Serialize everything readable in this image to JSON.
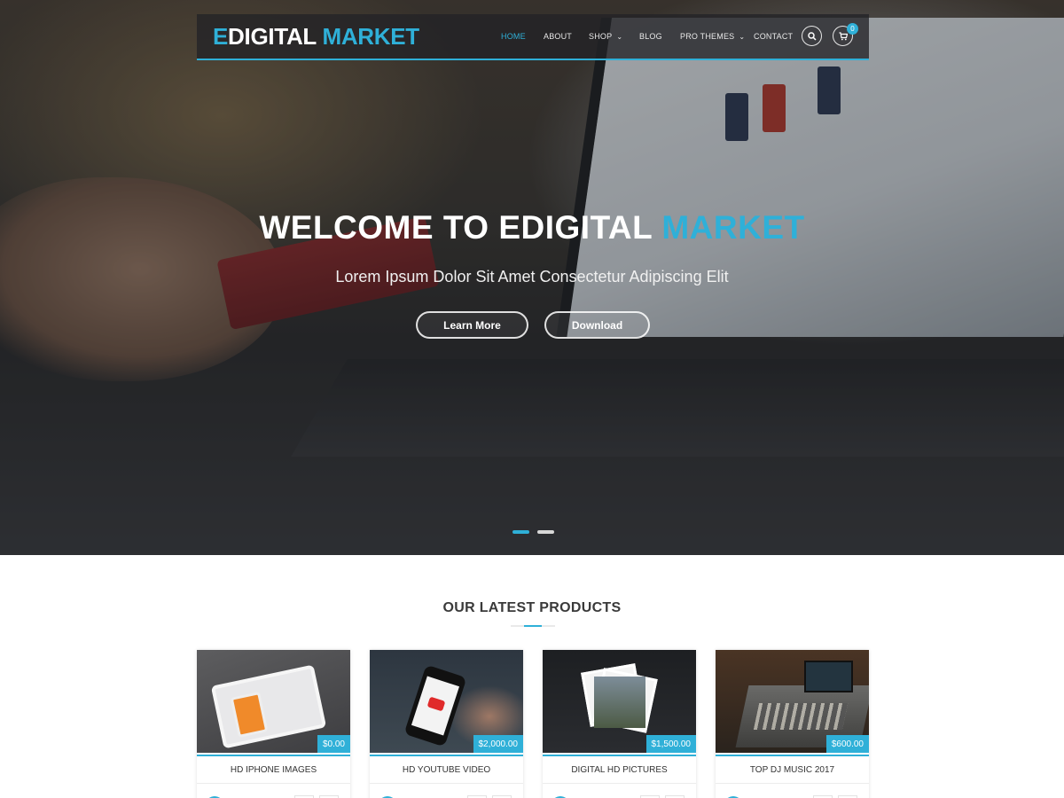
{
  "header": {
    "logo_prefix": "E",
    "logo_mid": "DIGITAL ",
    "logo_accent": "MARKET",
    "nav": [
      {
        "label": "HOME",
        "active": true
      },
      {
        "label": "ABOUT"
      },
      {
        "label": "SHOP"
      },
      {
        "label": "BLOG"
      },
      {
        "label": "PRO THEMES"
      },
      {
        "label": "CONTACT"
      }
    ],
    "search_icon": "search-icon",
    "cart_icon": "cart-icon",
    "cart_count": "0"
  },
  "hero": {
    "title_main": "WELCOME TO EDIGITAL ",
    "title_accent": "MARKET",
    "subtitle": "Lorem Ipsum Dolor Sit Amet Consectetur Adipiscing Elit",
    "learn_more": "Learn More",
    "download": "Download",
    "slides": [
      {
        "active": true
      },
      {
        "active": false
      }
    ]
  },
  "products": {
    "title": "OUR LATEST PRODUCTS",
    "items": [
      {
        "name": "HD IPHONE IMAGES",
        "price": "$0.00"
      },
      {
        "name": "HD YOUTUBE VIDEO",
        "price": "$2,000.00"
      },
      {
        "name": "DIGITAL HD PICTURES",
        "price": "$1,500.00"
      },
      {
        "name": "TOP DJ MUSIC 2017",
        "price": "$600.00"
      }
    ]
  },
  "colors": {
    "accent": "#2fb0d8",
    "header_bg": "#232326",
    "text_dark": "#3a3a3a"
  }
}
